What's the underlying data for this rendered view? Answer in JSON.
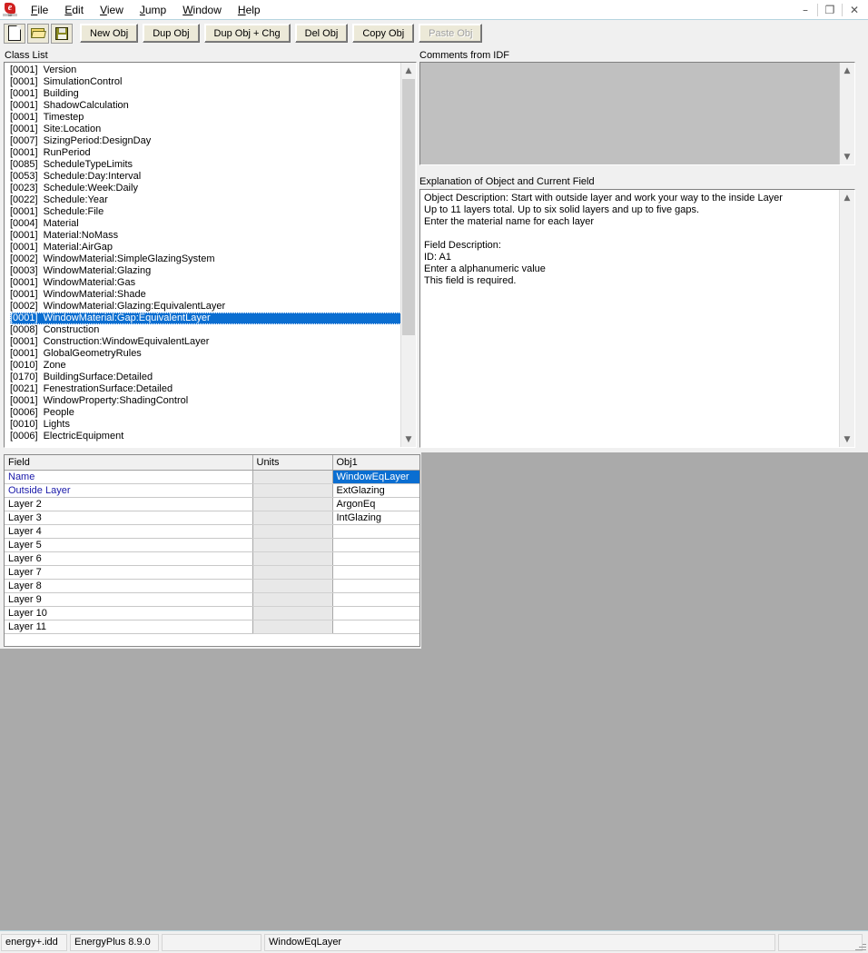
{
  "window": {
    "icon_name": "idf-editor-icon",
    "icon_text": "Idf",
    "minimize_label": "–",
    "restore_label": "❐",
    "close_label": "✕"
  },
  "menubar": {
    "items": [
      {
        "name": "menu-file",
        "label_pre": "",
        "accel": "F",
        "label_post": "ile"
      },
      {
        "name": "menu-edit",
        "label_pre": "",
        "accel": "E",
        "label_post": "dit"
      },
      {
        "name": "menu-view",
        "label_pre": "",
        "accel": "V",
        "label_post": "iew"
      },
      {
        "name": "menu-jump",
        "label_pre": "",
        "accel": "J",
        "label_post": "ump"
      },
      {
        "name": "menu-window",
        "label_pre": "",
        "accel": "W",
        "label_post": "indow"
      },
      {
        "name": "menu-help",
        "label_pre": "",
        "accel": "H",
        "label_post": "elp"
      }
    ]
  },
  "toolbar": {
    "icons": [
      {
        "name": "new-file-icon",
        "title": "New"
      },
      {
        "name": "open-file-icon",
        "title": "Open"
      },
      {
        "name": "save-file-icon",
        "title": "Save"
      }
    ],
    "buttons": [
      {
        "name": "new-obj-button",
        "label": "New Obj",
        "disabled": false
      },
      {
        "name": "dup-obj-button",
        "label": "Dup Obj",
        "disabled": false
      },
      {
        "name": "dup-obj-chg-button",
        "label": "Dup Obj + Chg",
        "disabled": false
      },
      {
        "name": "del-obj-button",
        "label": "Del Obj",
        "disabled": false
      },
      {
        "name": "copy-obj-button",
        "label": "Copy Obj",
        "disabled": false
      },
      {
        "name": "paste-obj-button",
        "label": "Paste Obj",
        "disabled": true
      }
    ]
  },
  "class_list": {
    "label": "Class List",
    "selected_index": 21,
    "items": [
      {
        "count": "[0001]",
        "name": "Version"
      },
      {
        "count": "[0001]",
        "name": "SimulationControl"
      },
      {
        "count": "[0001]",
        "name": "Building"
      },
      {
        "count": "[0001]",
        "name": "ShadowCalculation"
      },
      {
        "count": "[0001]",
        "name": "Timestep"
      },
      {
        "count": "[0001]",
        "name": "Site:Location"
      },
      {
        "count": "[0007]",
        "name": "SizingPeriod:DesignDay"
      },
      {
        "count": "[0001]",
        "name": "RunPeriod"
      },
      {
        "count": "[0085]",
        "name": "ScheduleTypeLimits"
      },
      {
        "count": "[0053]",
        "name": "Schedule:Day:Interval"
      },
      {
        "count": "[0023]",
        "name": "Schedule:Week:Daily"
      },
      {
        "count": "[0022]",
        "name": "Schedule:Year"
      },
      {
        "count": "[0001]",
        "name": "Schedule:File"
      },
      {
        "count": "[0004]",
        "name": "Material"
      },
      {
        "count": "[0001]",
        "name": "Material:NoMass"
      },
      {
        "count": "[0001]",
        "name": "Material:AirGap"
      },
      {
        "count": "[0002]",
        "name": "WindowMaterial:SimpleGlazingSystem"
      },
      {
        "count": "[0003]",
        "name": "WindowMaterial:Glazing"
      },
      {
        "count": "[0001]",
        "name": "WindowMaterial:Gas"
      },
      {
        "count": "[0001]",
        "name": "WindowMaterial:Shade"
      },
      {
        "count": "[0002]",
        "name": "WindowMaterial:Glazing:EquivalentLayer"
      },
      {
        "count": "[0001]",
        "name": "WindowMaterial:Gap:EquivalentLayer"
      },
      {
        "count": "[0008]",
        "name": "Construction"
      },
      {
        "count": "[0001]",
        "name": "Construction:WindowEquivalentLayer"
      },
      {
        "count": "[0001]",
        "name": "GlobalGeometryRules"
      },
      {
        "count": "[0010]",
        "name": "Zone"
      },
      {
        "count": "[0170]",
        "name": "BuildingSurface:Detailed"
      },
      {
        "count": "[0021]",
        "name": "FenestrationSurface:Detailed"
      },
      {
        "count": "[0001]",
        "name": "WindowProperty:ShadingControl"
      },
      {
        "count": "[0006]",
        "name": "People"
      },
      {
        "count": "[0010]",
        "name": "Lights"
      },
      {
        "count": "[0006]",
        "name": "ElectricEquipment"
      }
    ]
  },
  "comments": {
    "label": "Comments from IDF",
    "value": ""
  },
  "explanation": {
    "label": "Explanation of Object and Current Field",
    "lines": [
      "Object Description: Start with outside layer and work your way to the inside Layer",
      "Up to 11 layers total. Up to six solid layers and up to five gaps.",
      "Enter the material name for each layer",
      "",
      "Field Description:",
      "ID: A1",
      "Enter a alphanumeric value",
      "This field is required."
    ]
  },
  "grid": {
    "headers": [
      "Field",
      "Units",
      "Obj1"
    ],
    "selected_row": 0,
    "rows": [
      {
        "field": "Name",
        "required": true,
        "units": "",
        "obj1": "WindowEqLayer"
      },
      {
        "field": "Outside Layer",
        "required": true,
        "units": "",
        "obj1": "ExtGlazing"
      },
      {
        "field": "Layer 2",
        "required": false,
        "units": "",
        "obj1": "ArgonEq"
      },
      {
        "field": "Layer 3",
        "required": false,
        "units": "",
        "obj1": "IntGlazing"
      },
      {
        "field": "Layer 4",
        "required": false,
        "units": "",
        "obj1": ""
      },
      {
        "field": "Layer 5",
        "required": false,
        "units": "",
        "obj1": ""
      },
      {
        "field": "Layer 6",
        "required": false,
        "units": "",
        "obj1": ""
      },
      {
        "field": "Layer 7",
        "required": false,
        "units": "",
        "obj1": ""
      },
      {
        "field": "Layer 8",
        "required": false,
        "units": "",
        "obj1": ""
      },
      {
        "field": "Layer 9",
        "required": false,
        "units": "",
        "obj1": ""
      },
      {
        "field": "Layer 10",
        "required": false,
        "units": "",
        "obj1": ""
      },
      {
        "field": "Layer 11",
        "required": false,
        "units": "",
        "obj1": ""
      }
    ]
  },
  "statusbar": {
    "idd_file": "energy+.idd",
    "version": "EnergyPlus 8.9.0",
    "panel3": "",
    "current_object": "WindowEqLayer",
    "panel5": ""
  },
  "colors": {
    "selection_blue": "#0a6ed1",
    "required_field_text": "#1a1aaa",
    "backdrop_grey": "#aaaaaa",
    "panel_face": "#f0f0f0",
    "disabled_field": "#c0c0c0"
  }
}
